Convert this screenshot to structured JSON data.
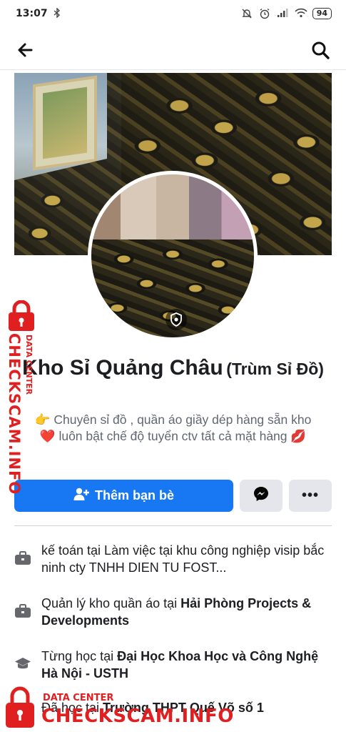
{
  "status_bar": {
    "time": "13:07",
    "battery": "94",
    "icons": [
      "bluetooth-icon",
      "mute-icon",
      "alarm-icon",
      "signal-icon",
      "wifi-icon"
    ]
  },
  "navbar": {
    "back_icon": "arrow-left-icon",
    "search_icon": "search-icon"
  },
  "profile": {
    "name_main": "Kho Sỉ Quảng Châu",
    "name_alt": "(Trùm Sỉ Đồ)",
    "bio_emoji": "👉",
    "bio_part1": " Chuyên sỉ đồ , quần áo giầy dép hàng sẵn kho ",
    "bio_heart": "❤️",
    "bio_part2": " luôn bật chế độ tuyển ctv tất cả mặt hàng ",
    "bio_lips": "💋"
  },
  "actions": {
    "add_friend_label": "Thêm bạn bè",
    "more_label": "•••"
  },
  "details": [
    {
      "icon": "briefcase-icon",
      "prefix": "kế toán tại Làm việc tại khu công nghiệp visip bắc ninh cty TNHH DIEN TU FOST...",
      "bold": ""
    },
    {
      "icon": "briefcase-icon",
      "prefix": "Quản lý kho quần áo tại ",
      "bold": "Hải Phòng Projects & Developments"
    },
    {
      "icon": "graduation-cap-icon",
      "prefix": "Từng học tại ",
      "bold": "Đại Học Khoa Học và Công Nghệ Hà Nội - USTH"
    },
    {
      "icon": "graduation-cap-icon",
      "prefix": "Đã học tại ",
      "bold": "Trường THPT Quế Võ số 1"
    }
  ],
  "watermark": {
    "side_big": "CHECKSCAM.INFO",
    "side_small": "DATA CENTER",
    "bottom_small": "DATA CENTER",
    "bottom_big": "CHECKSCAM.INFO"
  },
  "colors": {
    "accent": "#1877f2",
    "secondary_button": "#e4e6eb",
    "watermark": "#e02020"
  }
}
